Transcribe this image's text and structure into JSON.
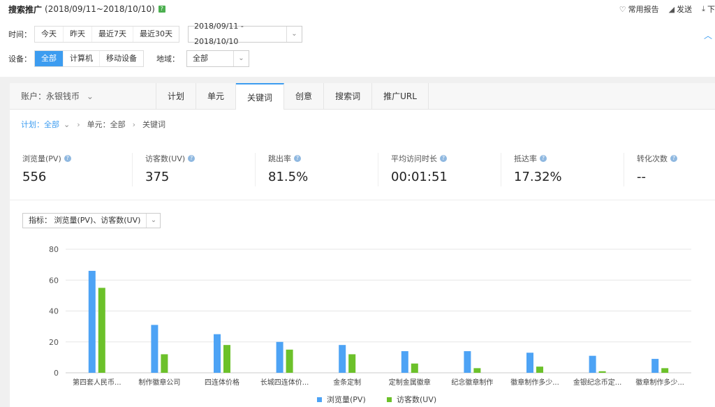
{
  "header": {
    "title": "搜索推广",
    "date_range": "(2018/09/11~2018/10/10)",
    "help_badge": "?",
    "actions": [
      {
        "icon": "heart-icon",
        "label": "常用报告"
      },
      {
        "icon": "send-icon",
        "label": "发送"
      },
      {
        "icon": "download-icon",
        "label": "下"
      }
    ]
  },
  "time_filter": {
    "label": "时间：",
    "options": [
      "今天",
      "昨天",
      "最近7天",
      "最近30天"
    ],
    "date_select": "2018/09/11 - 2018/10/10"
  },
  "device_filter": {
    "label": "设备：",
    "options": [
      "全部",
      "计算机",
      "移动设备"
    ],
    "active": "全部"
  },
  "region_filter": {
    "label": "地域：",
    "value": "全部"
  },
  "tabs": {
    "account": "账户：永银钱币",
    "items": [
      "计划",
      "单元",
      "关键词",
      "创意",
      "搜索词",
      "推广URL"
    ],
    "active": "关键词"
  },
  "breadcrumb": {
    "plan": "计划：全部",
    "unit": "单元：全部",
    "current": "关键词"
  },
  "metrics": [
    {
      "label": "浏览量(PV)",
      "value": "556"
    },
    {
      "label": "访客数(UV)",
      "value": "375"
    },
    {
      "label": "跳出率",
      "value": "81.5%"
    },
    {
      "label": "平均访问时长",
      "value": "00:01:51"
    },
    {
      "label": "抵达率",
      "value": "17.32%"
    },
    {
      "label": "转化次数",
      "value": "--"
    }
  ],
  "indicator": "指标： 浏览量(PV)、访客数(UV)",
  "colors": {
    "accent": "#3c9cf0",
    "pv": "#4da3f5",
    "uv": "#6cc12a"
  },
  "chart_data": {
    "type": "bar",
    "categories": [
      "第四套人民币...",
      "制作徽章公司",
      "四连体价格",
      "长城四连体价...",
      "金条定制",
      "定制金属徽章",
      "纪念徽章制作",
      "徽章制作多少...",
      "金银纪念币定...",
      "徽章制作多少..."
    ],
    "series": [
      {
        "name": "浏览量(PV)",
        "values": [
          66,
          31,
          25,
          20,
          18,
          14,
          14,
          13,
          11,
          9
        ]
      },
      {
        "name": "访客数(UV)",
        "values": [
          55,
          12,
          18,
          15,
          12,
          6,
          3,
          4,
          1,
          3
        ]
      }
    ],
    "ylim": [
      0,
      80
    ],
    "yticks": [
      0,
      20,
      40,
      60,
      80
    ],
    "legend": "bottom",
    "grid": true
  }
}
